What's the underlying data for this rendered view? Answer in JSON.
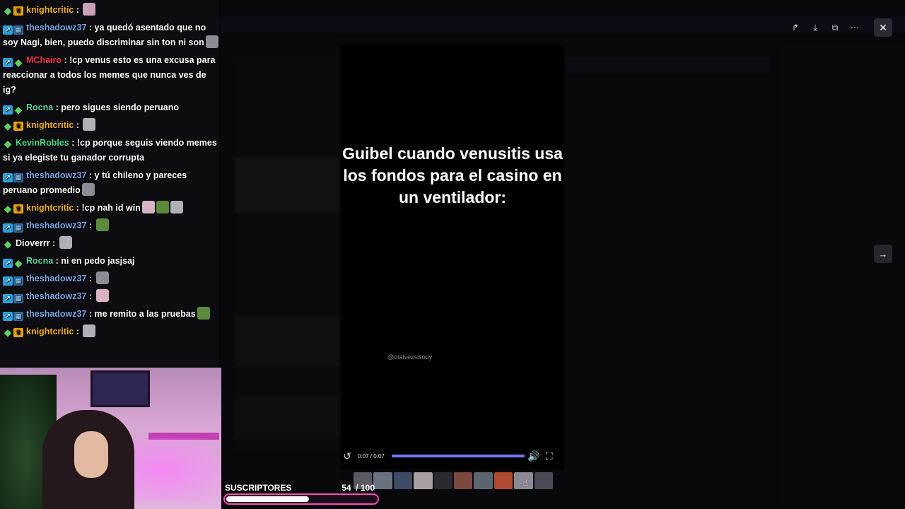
{
  "chat": {
    "messages": [
      {
        "badges": [
          "vip",
          "crown"
        ],
        "user": "knightcritic",
        "color": "#f5b400",
        "text": " : ",
        "emotes": 1
      },
      {
        "badges": [
          "prime",
          "sub"
        ],
        "user": "theshadowz37",
        "color": "#78a8e6",
        "text": " : ya quedó asentado que no soy Nagi, bien, puedo discriminar sin ton ni son",
        "emotes": 1
      },
      {
        "badges": [
          "prime",
          "vip"
        ],
        "user": "MChairo",
        "color": "#ff2d55",
        "text": " : !cp venus esto es una excusa para reaccionar a todos los memes que nunca ves de ig?",
        "emotes": 0
      },
      {
        "badges": [
          "prime",
          "vip"
        ],
        "user": "Rocna",
        "color": "#5ed6a3",
        "text": " : pero sigues siendo peruano",
        "emotes": 0
      },
      {
        "badges": [
          "vip",
          "crown"
        ],
        "user": "knightcritic",
        "color": "#f5b400",
        "text": " : ",
        "emotes": 1
      },
      {
        "badges": [
          "vip"
        ],
        "user": "KevinRobles",
        "color": "#3fdc8b",
        "text": " : !cp porque seguis viendo memes si ya elegiste tu ganador corrupta",
        "emotes": 0
      },
      {
        "badges": [
          "prime",
          "sub"
        ],
        "user": "theshadowz37",
        "color": "#78a8e6",
        "text": " : y tú chileno y pareces peruano promedio",
        "emotes": 1
      },
      {
        "badges": [
          "vip",
          "crown"
        ],
        "user": "knightcritic",
        "color": "#f5b400",
        "text": " : !cp nah id win",
        "emotes": 3
      },
      {
        "badges": [
          "prime",
          "sub"
        ],
        "user": "theshadowz37",
        "color": "#78a8e6",
        "text": " : ",
        "emotes": 1
      },
      {
        "badges": [
          "vip"
        ],
        "user": "Dioverrr",
        "color": "#ffffff",
        "text": " : ",
        "emotes": 1
      },
      {
        "badges": [
          "prime",
          "vip"
        ],
        "user": "Rocna",
        "color": "#5ed6a3",
        "text": " : ni en pedo jasjsaj",
        "emotes": 0
      },
      {
        "badges": [
          "prime",
          "sub"
        ],
        "user": "theshadowz37",
        "color": "#78a8e6",
        "text": " : ",
        "emotes": 1
      },
      {
        "badges": [
          "prime",
          "sub"
        ],
        "user": "theshadowz37",
        "color": "#78a8e6",
        "text": " : ",
        "emotes": 1
      },
      {
        "badges": [
          "prime",
          "sub"
        ],
        "user": "theshadowz37",
        "color": "#78a8e6",
        "text": " : me remito a las pruebas",
        "emotes": 1
      },
      {
        "badges": [
          "vip",
          "crown"
        ],
        "user": "knightcritic",
        "color": "#f5b400",
        "text": " : ",
        "emotes": 1
      }
    ]
  },
  "video": {
    "caption": "Guibel cuando venusitis usa los fondos para el casino en un ventilador:",
    "watermark": "@otalvezsisooy",
    "time": "0:07 / 0:07",
    "progress": 1.0,
    "thumbnail_count": 10
  },
  "subs": {
    "label": "SUSCRIPTORES",
    "current": 54,
    "goal": 100,
    "count_text": "54  / 100"
  },
  "icons": {
    "replay": "↺",
    "volume": "🔊",
    "fullscreen": "⛶",
    "share": "↱",
    "download": "⤓",
    "open_external": "⧉",
    "more": "⋯",
    "close": "✕",
    "next": "→",
    "cursor": "☝"
  },
  "colors": {
    "seek_fill": "#6f77ff",
    "subs_border": "#ff4ab6"
  }
}
